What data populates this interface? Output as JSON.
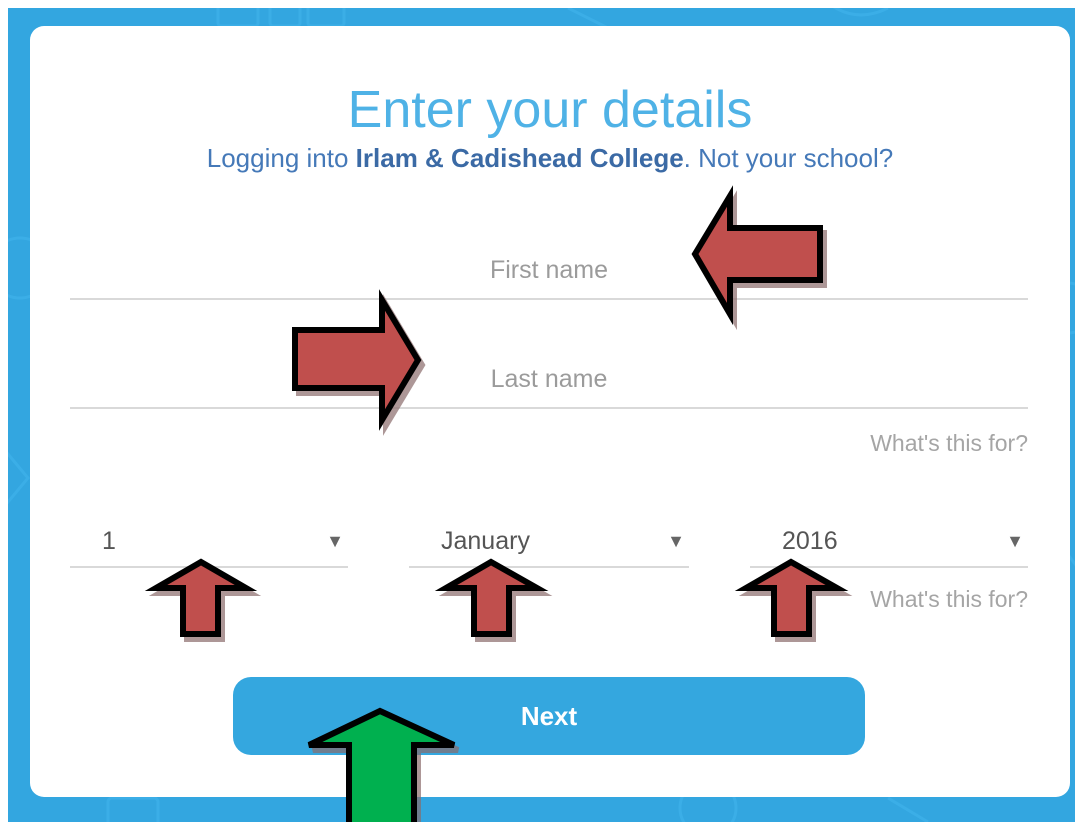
{
  "form": {
    "title": "Enter your details",
    "subtitle_prefix": "Logging into ",
    "school": "Irlam & Cadishead College",
    "subtitle_suffix": ". Not your school?",
    "first_name": {
      "placeholder": "First name",
      "value": ""
    },
    "last_name": {
      "placeholder": "Last name",
      "value": ""
    },
    "help_text_1": "What's this for?",
    "dob": {
      "day": "1",
      "month": "January",
      "year": "2016"
    },
    "help_text_2": "What's this for?",
    "next_label": "Next"
  },
  "icons": {
    "caret": "▼",
    "annotation_arrows": [
      "red-left-arrow",
      "red-right-arrow",
      "red-up-arrow",
      "red-up-arrow",
      "red-up-arrow",
      "green-up-arrow"
    ]
  },
  "colors": {
    "frame_background": "#33a6e0",
    "title": "#4fb2e6",
    "subtitle": "#4579b8",
    "button": "#34a7df",
    "annotation_red": "#c0504d",
    "annotation_green": "#00b050"
  }
}
